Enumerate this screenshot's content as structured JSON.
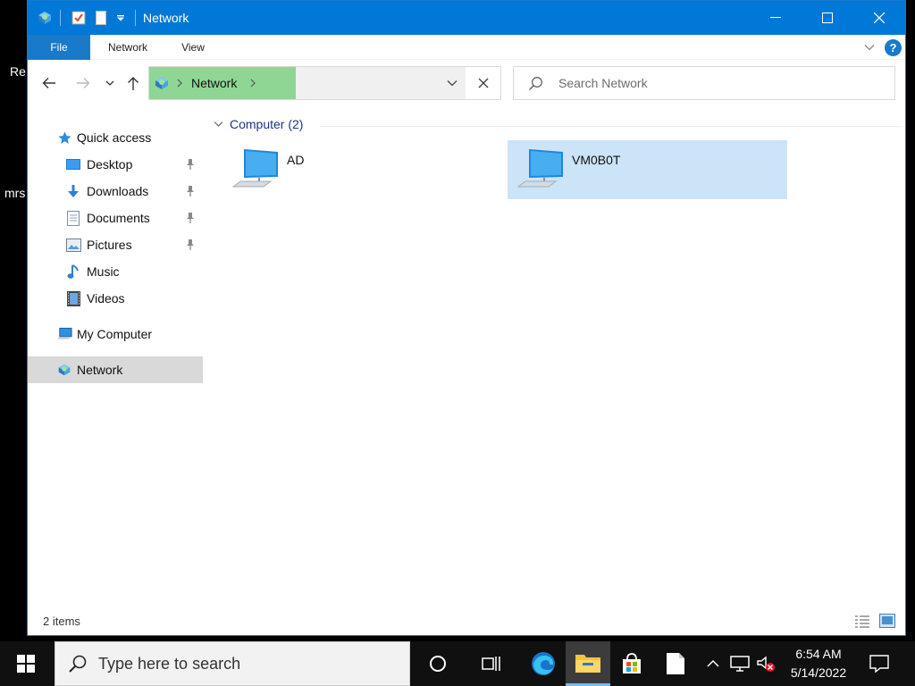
{
  "desktop": {
    "label_re": "Re",
    "label_mrs": "mrs"
  },
  "window": {
    "title": "Network",
    "ribbon_tabs": [
      {
        "label": "File"
      },
      {
        "label": "Network"
      },
      {
        "label": "View"
      }
    ],
    "help_label": "?",
    "address": {
      "crumb": "Network"
    },
    "search": {
      "placeholder": "Search Network"
    },
    "nav_pane": {
      "quick_access": "Quick access",
      "items": [
        {
          "label": "Desktop",
          "pinned": true
        },
        {
          "label": "Downloads",
          "pinned": true
        },
        {
          "label": "Documents",
          "pinned": true
        },
        {
          "label": "Pictures",
          "pinned": true
        },
        {
          "label": "Music",
          "pinned": false
        },
        {
          "label": "Videos",
          "pinned": false
        }
      ],
      "my_computer": "My Computer",
      "network": "Network"
    },
    "content": {
      "group_header": "Computer (2)",
      "computers": [
        {
          "name": "AD",
          "selected": false
        },
        {
          "name": "VM0B0T",
          "selected": true
        }
      ]
    },
    "status": {
      "items_count": "2 items"
    }
  },
  "taskbar": {
    "search_placeholder": "Type here to search",
    "time": "6:54 AM",
    "date": "5/14/2022"
  },
  "colors": {
    "titlebar": "#0078d7",
    "file_tab": "#1979ca",
    "breadcrumb_highlight": "#8fd694",
    "selection": "#cce4f7",
    "nav_selected": "#d9d9d9"
  }
}
